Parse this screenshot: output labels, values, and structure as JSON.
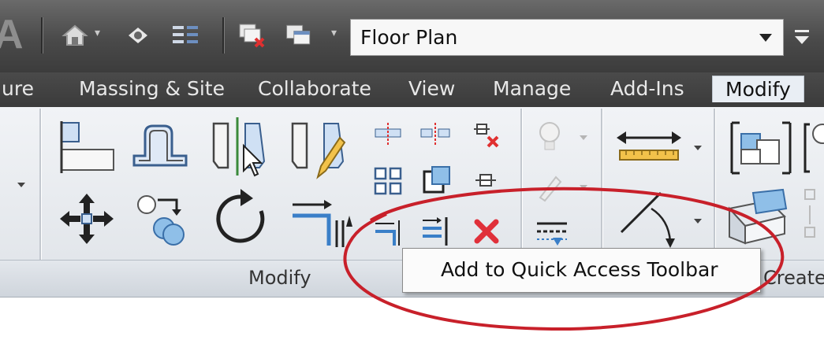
{
  "title_bar": {
    "app_letter": "A",
    "view_selector_value": "Floor Plan"
  },
  "tabs": [
    {
      "label": "ure",
      "active": false
    },
    {
      "label": "Massing & Site",
      "active": false
    },
    {
      "label": "Collaborate",
      "active": false
    },
    {
      "label": "View",
      "active": false
    },
    {
      "label": "Manage",
      "active": false
    },
    {
      "label": "Add-Ins",
      "active": false
    },
    {
      "label": "Modify",
      "active": true
    }
  ],
  "panels": {
    "modify_label": "Modify",
    "create_label": "Create"
  },
  "context_menu": {
    "item": "Add to Quick Access Toolbar"
  },
  "colors": {
    "titlebar": "#4a4a4a",
    "ribbon": "#e8ebef",
    "highlight_ellipse": "#c8202a",
    "delete_x": "#e0303a",
    "tool_blue": "#3a7fc8"
  }
}
